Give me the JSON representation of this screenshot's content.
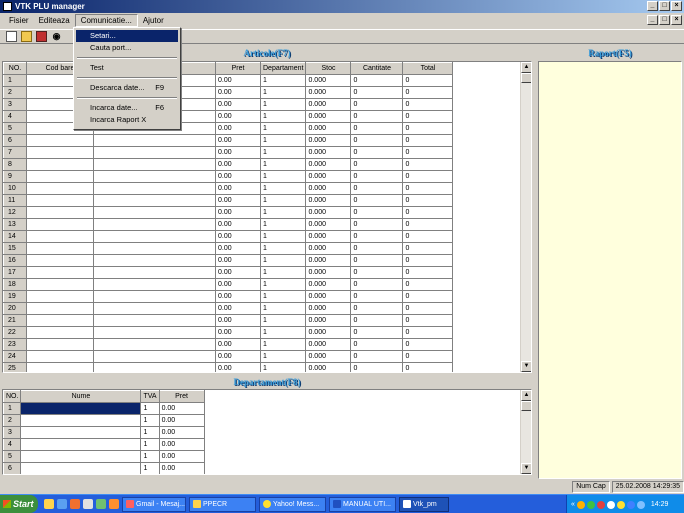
{
  "window": {
    "title": "VTK PLU manager",
    "btn_min": "_",
    "btn_max": "□",
    "btn_close": "×"
  },
  "menubar": {
    "items": [
      "Fisier",
      "Editeaza",
      "Comunicatie...",
      "Ajutor"
    ]
  },
  "dropdown": {
    "items": [
      {
        "label": "Setari...",
        "shortcut": ""
      },
      {
        "label": "Cauta port...",
        "shortcut": ""
      },
      {
        "label": "Test",
        "shortcut": ""
      },
      {
        "label": "Descarca date...",
        "shortcut": "F9"
      },
      {
        "label": "Incarca date...",
        "shortcut": "F6"
      },
      {
        "label": "Incarca Raport X",
        "shortcut": ""
      }
    ]
  },
  "articole": {
    "title": "Articole(F7)",
    "headers": [
      "NO.",
      "Cod bare",
      "",
      "Pret",
      "Departament",
      "Stoc",
      "Cantitate",
      "Total"
    ],
    "rows": [
      "1",
      "2",
      "3",
      "4",
      "5",
      "6",
      "7",
      "8",
      "9",
      "10",
      "11",
      "12",
      "13",
      "14",
      "15",
      "16",
      "17",
      "18",
      "19",
      "20",
      "21",
      "22",
      "23",
      "24",
      "25"
    ],
    "pret": "0.00",
    "departament": "1",
    "stoc": "0.000",
    "cantitate": "0",
    "total": "0"
  },
  "departament": {
    "title": "Departament(F8)",
    "headers": [
      "NO.",
      "Nume",
      "TVA",
      "Pret"
    ],
    "rows": [
      "1",
      "2",
      "3",
      "4",
      "5",
      "6"
    ],
    "tva": "1",
    "pret": "0.00"
  },
  "raport": {
    "title": "Raport(F5)"
  },
  "statusbar": {
    "num": "Num",
    "cap": "Cap",
    "datetime": "25.02.2008 14:29:35"
  },
  "taskbar": {
    "start": "Start",
    "tasks": [
      "Gmail - Mesaj...",
      "PPECR",
      "Yahoo! Mess...",
      "MANUAL UTI...",
      "Vtk_pm"
    ],
    "clock": "14:29"
  }
}
